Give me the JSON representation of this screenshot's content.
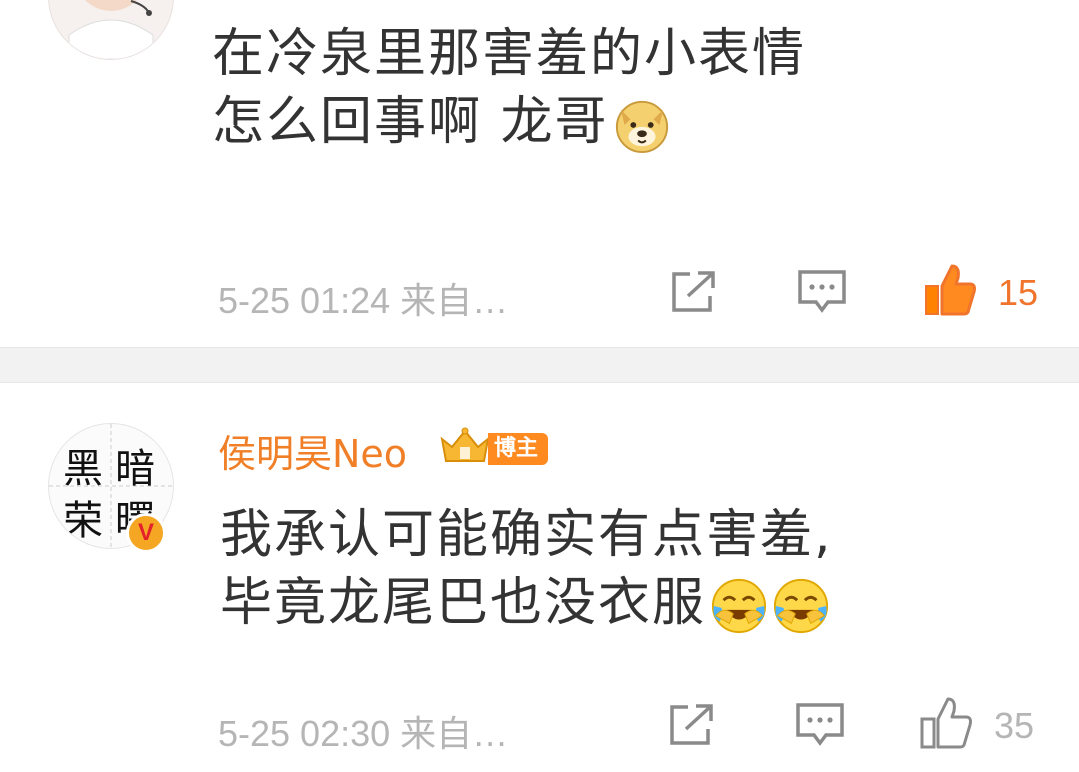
{
  "comments": [
    {
      "lines": [
        "在冷泉里那害羞的小表情",
        "怎么回事啊 龙哥"
      ],
      "emoji": "doge-emoji",
      "time": "5-25 01:24",
      "source": "来自…",
      "likes": "15",
      "liked": true
    },
    {
      "username": "侯明昊Neo",
      "badge": "博主",
      "avatar_chars": [
        "黑",
        "暗",
        "荣",
        "曙"
      ],
      "lines": [
        "我承认可能确实有点害羞,",
        "毕竟龙尾巴也没衣服"
      ],
      "emoji": "laugh-cry-emoji",
      "time": "5-25 02:30",
      "source": "来自…",
      "likes": "35",
      "liked": false
    }
  ],
  "colors": {
    "username": "#f07f27",
    "like_active": "#f0742b",
    "meta": "#b5b5b5",
    "divider": "#f2f2f2",
    "text": "#333333"
  }
}
